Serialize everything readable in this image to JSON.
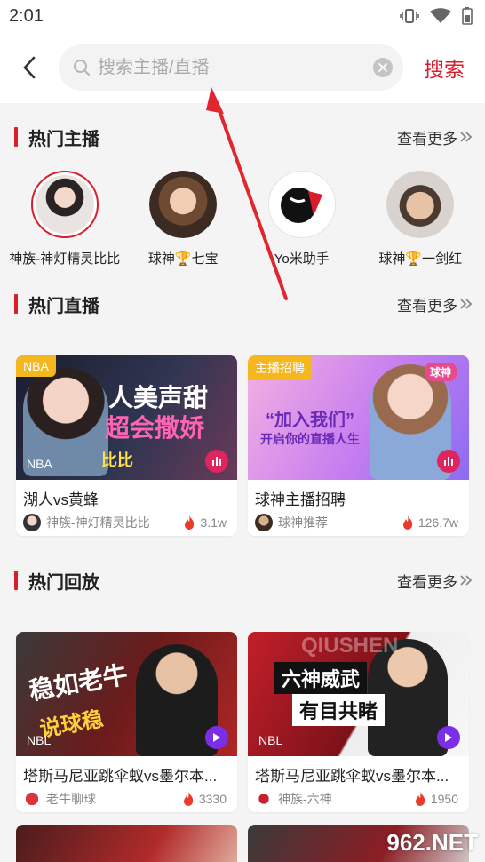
{
  "status": {
    "time": "2:01"
  },
  "search": {
    "placeholder": "搜索主播/直播",
    "button_label": "搜索"
  },
  "sections": {
    "anchors": {
      "title": "热门主播",
      "more": "查看更多"
    },
    "live": {
      "title": "热门直播",
      "more": "查看更多"
    },
    "replay": {
      "title": "热门回放",
      "more": "查看更多"
    }
  },
  "anchors": [
    {
      "name": "神族-神灯精灵比比"
    },
    {
      "name": "球神🏆七宝"
    },
    {
      "name": "Yo米助手"
    },
    {
      "name": "球神🏆一剑红"
    }
  ],
  "live_cards": [
    {
      "tag": "NBA",
      "category": "NBA",
      "thumb_line1": "人美声甜",
      "thumb_line2": "超会撒娇",
      "thumb_sub": "比比",
      "title": "湖人vs黄蜂",
      "author": "神族-神灯精灵比比",
      "heat": "3.1w"
    },
    {
      "tag": "主播招聘",
      "category": "",
      "thumb_line1": "“加入我们”",
      "thumb_line2": "开启你的直播人生",
      "thumb_sub": "球神",
      "title": "球神主播招聘",
      "author": "球神推荐",
      "heat": "126.7w"
    }
  ],
  "replay_cards": [
    {
      "category": "NBL",
      "thumb_line1": "稳如老牛",
      "thumb_line2": "说球稳",
      "title": "塔斯马尼亚跳伞蚁vs墨尔本...",
      "author": "老牛聊球",
      "heat": "3330"
    },
    {
      "category": "NBL",
      "thumb_line1": "六神威武",
      "thumb_line2": "有目共睹",
      "thumb_sub": "QIUSHEN",
      "title": "塔斯马尼亚跳伞蚁vs墨尔本...",
      "author": "神族-六神",
      "heat": "1950"
    }
  ],
  "watermark": "962.NET",
  "colors": {
    "accent": "#d81e2c",
    "tag": "#f5b71e",
    "live_badge": "#e0245e",
    "play_badge": "#7a2ee6"
  }
}
